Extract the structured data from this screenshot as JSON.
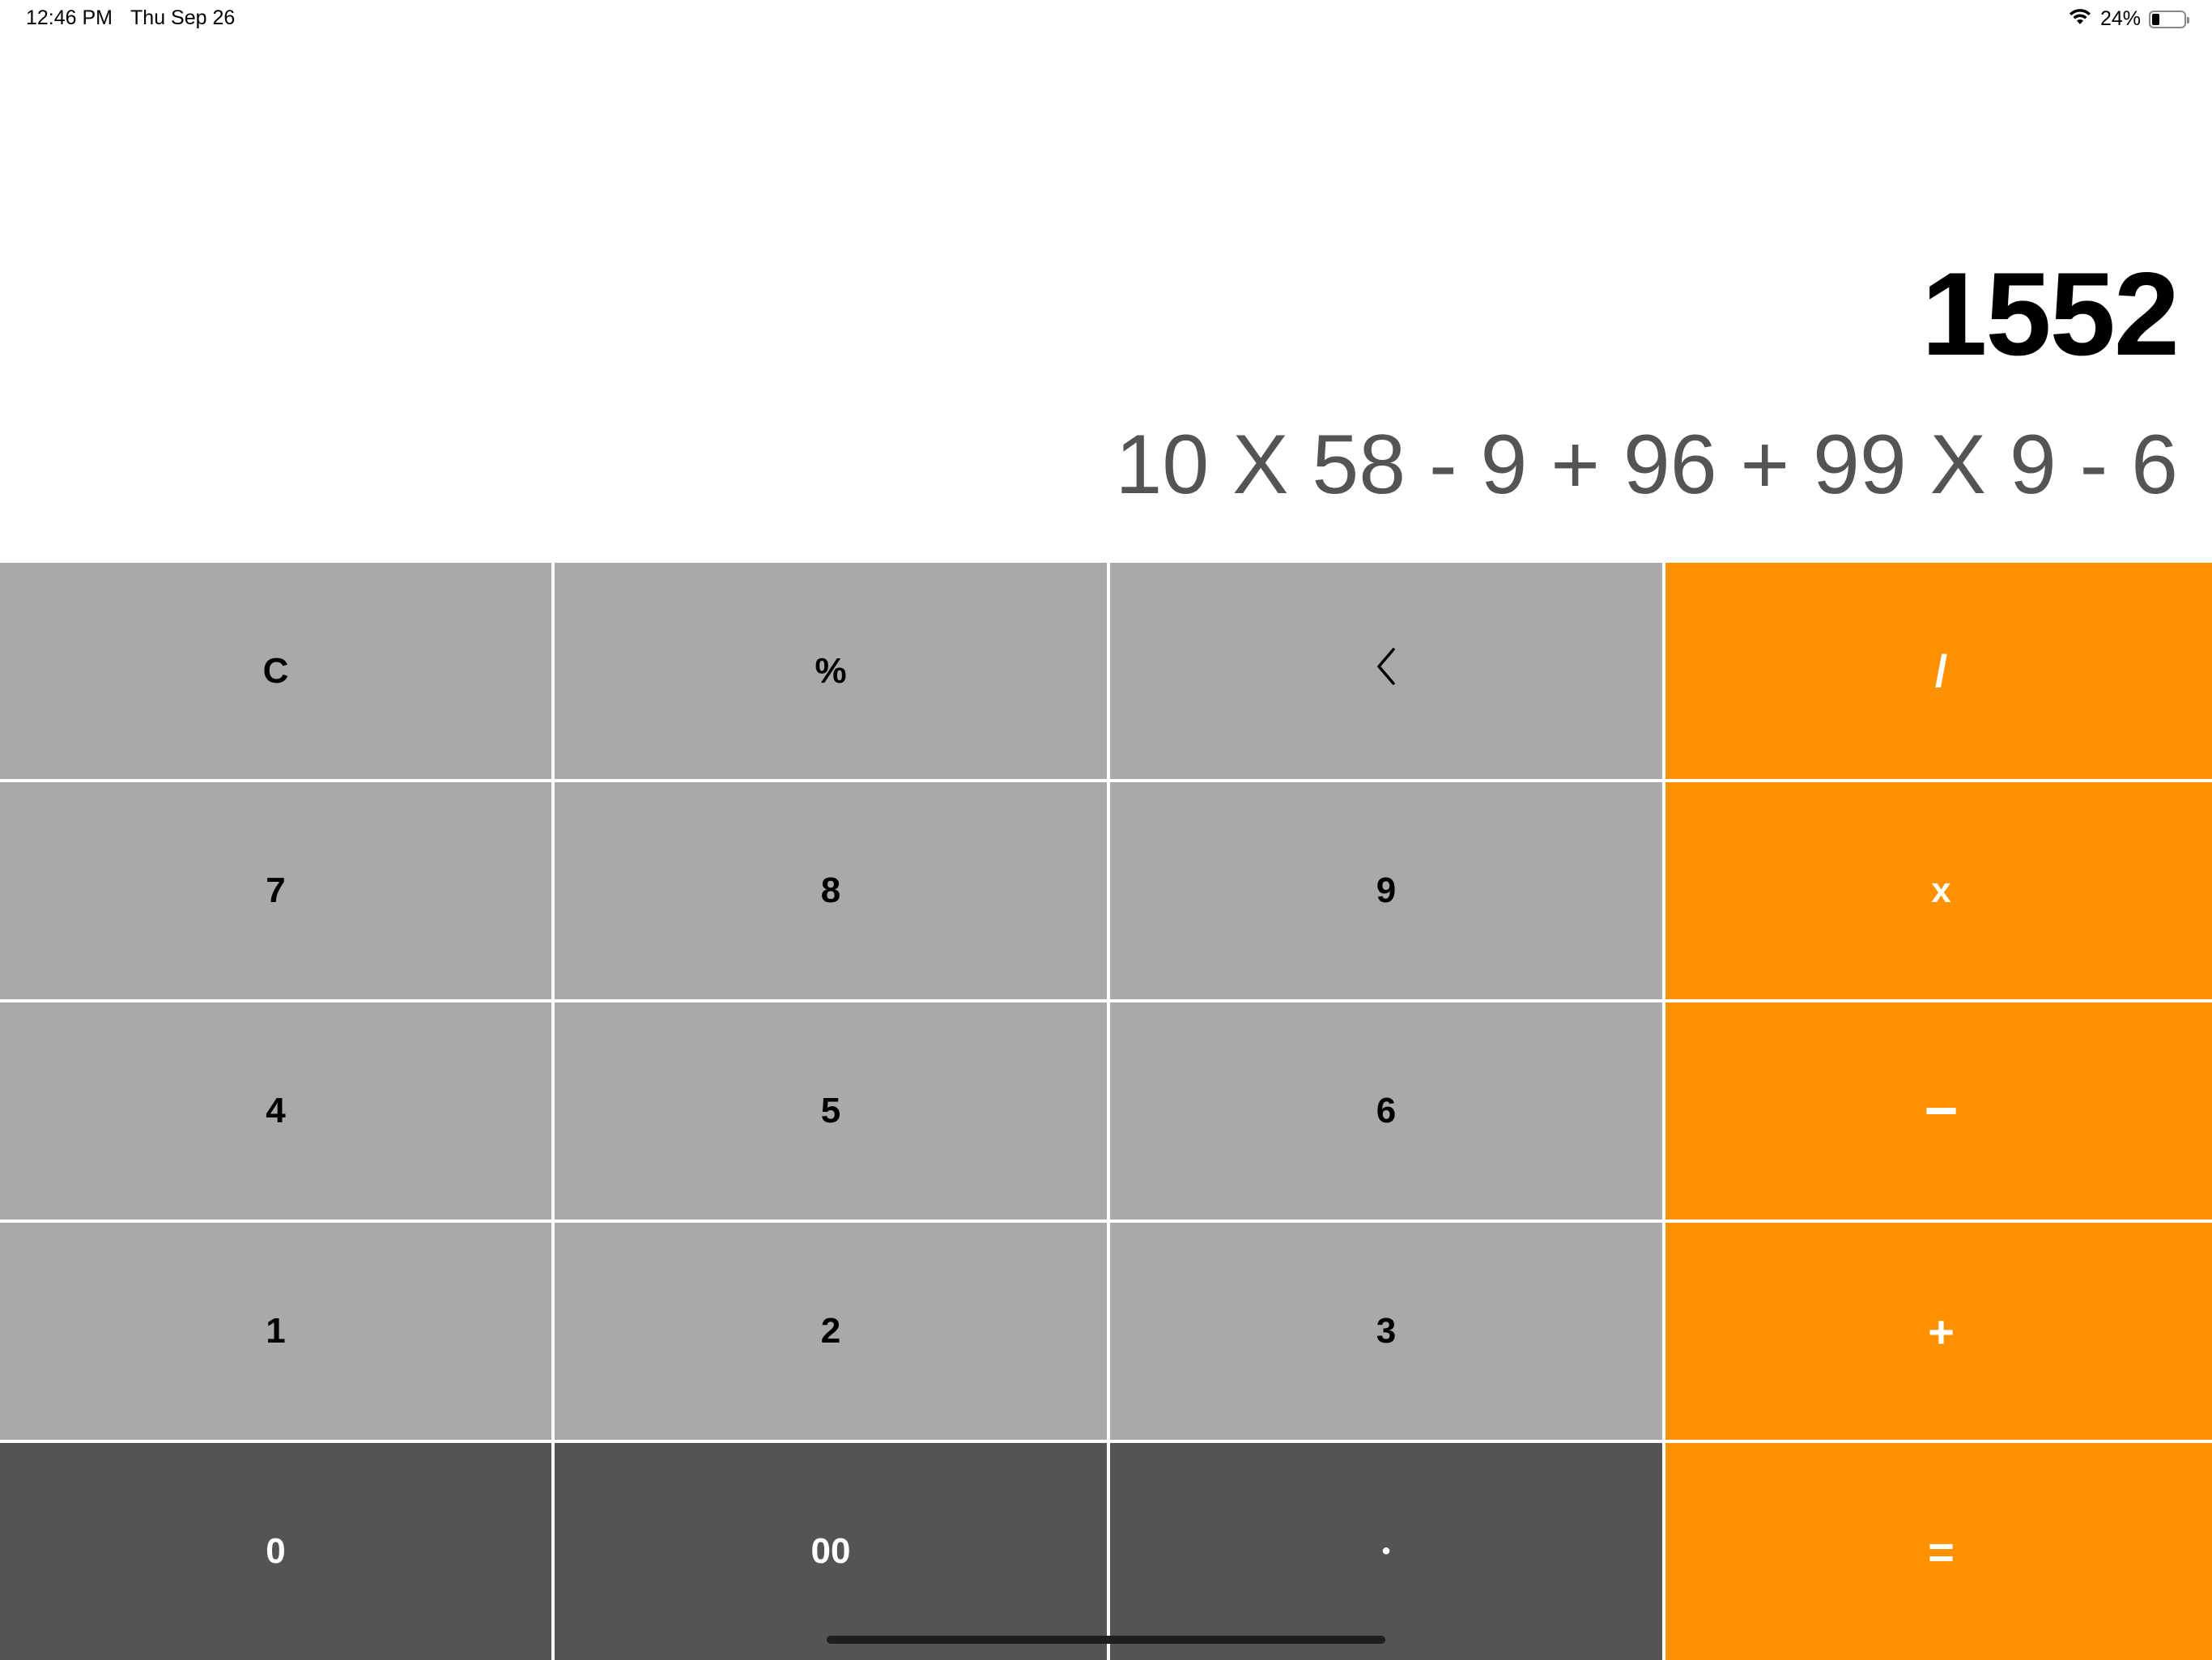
{
  "status_bar": {
    "time": "12:46 PM",
    "date": "Thu Sep 26",
    "battery_text": "24%",
    "battery_level": 0.24
  },
  "display": {
    "result": "1552",
    "expression": "10 X 58 - 9 + 96 + 99 X 9 - 6"
  },
  "keys": {
    "clear": "C",
    "percent": "%",
    "backspace": "‹",
    "divide": "/",
    "seven": "7",
    "eight": "8",
    "nine": "9",
    "multiply": "x",
    "four": "4",
    "five": "5",
    "six": "6",
    "subtract": "−",
    "one": "1",
    "two": "2",
    "three": "3",
    "add": "+",
    "zero": "0",
    "double_zero": "00",
    "decimal": "•",
    "equals": "="
  },
  "colors": {
    "function_key": "#a9a9a9",
    "number_key_dark": "#545454",
    "operator_key": "#fe9100"
  }
}
